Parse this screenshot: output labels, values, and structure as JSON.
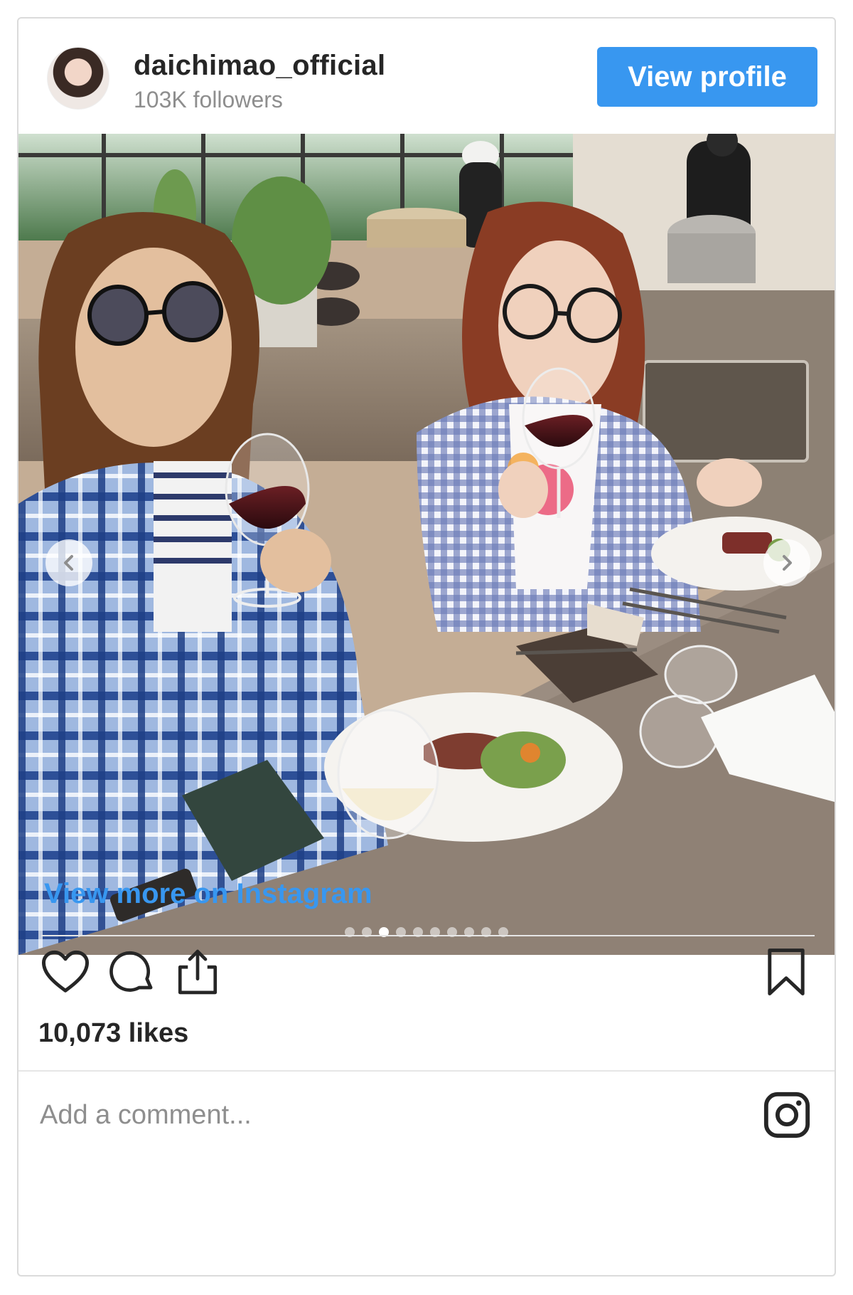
{
  "header": {
    "username": "daichimao_official",
    "followers": "103K followers",
    "view_profile_label": "View profile"
  },
  "post": {
    "view_more_label": "View more on Instagram",
    "likes": "10,073 likes",
    "comment_placeholder": "Add a comment...",
    "carousel_count": 10,
    "carousel_active_index": 2
  },
  "icons": {
    "like": "heart-icon",
    "comment": "comment-icon",
    "share": "share-icon",
    "save": "bookmark-icon",
    "brand": "instagram-icon",
    "prev": "chevron-left-icon",
    "next": "chevron-right-icon"
  },
  "colors": {
    "accent": "#3897f0",
    "text": "#262626",
    "muted": "#8e8e8e",
    "border": "#dbdbdb"
  }
}
